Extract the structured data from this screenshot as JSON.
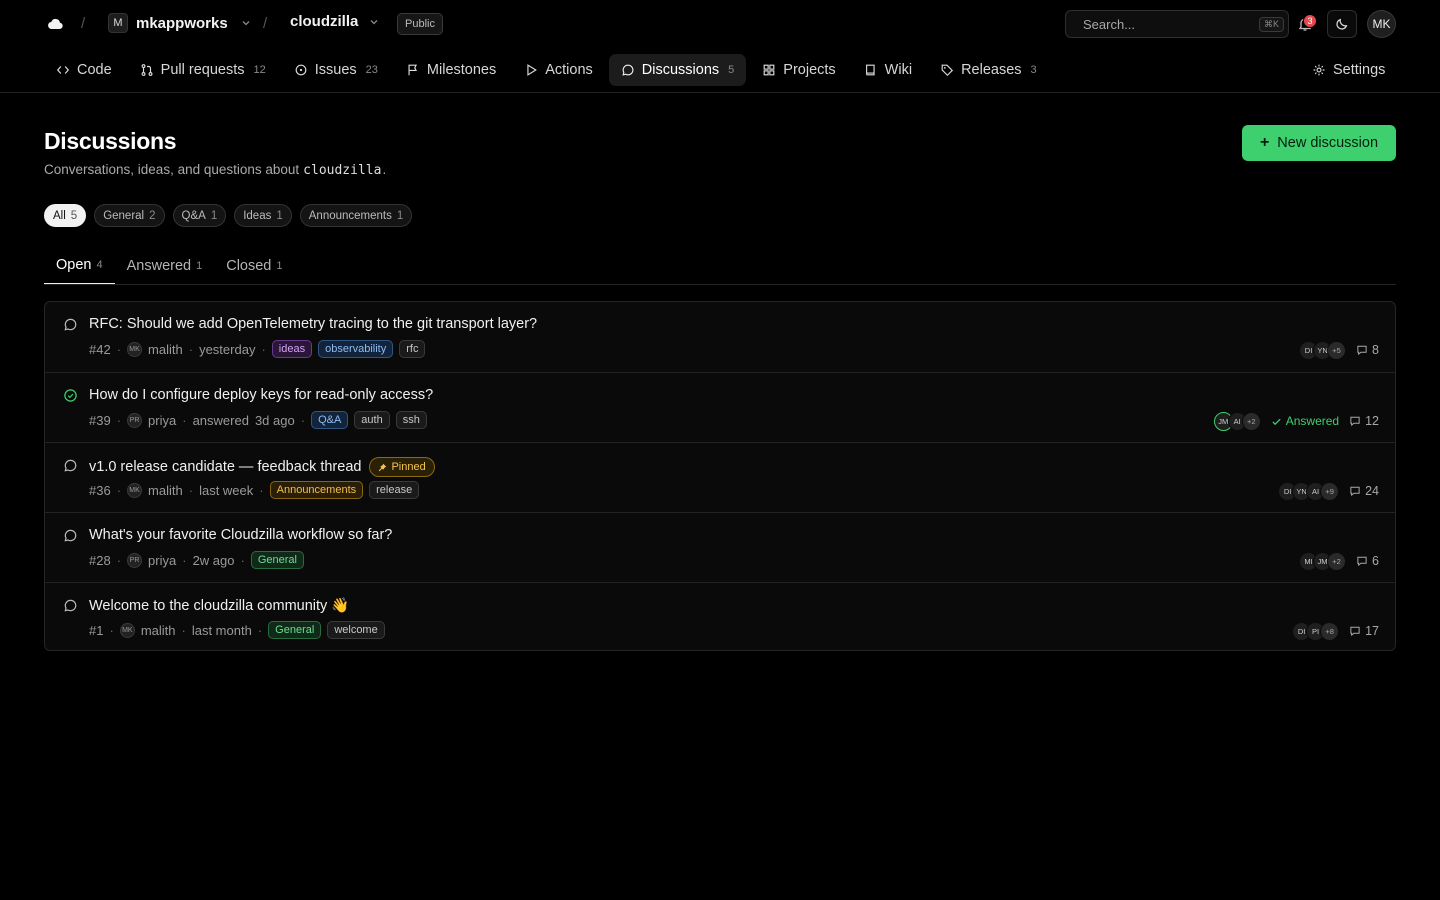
{
  "topbar": {
    "org_initial": "M",
    "org_name": "mkappworks",
    "repo_name": "cloudzilla",
    "visibility": "Public",
    "search_placeholder": "Search...",
    "search_shortcut": "⌘K",
    "notification_count": "3",
    "user_initials": "MK"
  },
  "nav": {
    "items": [
      {
        "label": "Code",
        "count": ""
      },
      {
        "label": "Pull requests",
        "count": "12"
      },
      {
        "label": "Issues",
        "count": "23"
      },
      {
        "label": "Milestones",
        "count": ""
      },
      {
        "label": "Actions",
        "count": ""
      },
      {
        "label": "Discussions",
        "count": "5"
      },
      {
        "label": "Projects",
        "count": ""
      },
      {
        "label": "Wiki",
        "count": ""
      },
      {
        "label": "Releases",
        "count": "3"
      }
    ],
    "settings_label": "Settings"
  },
  "header": {
    "title": "Discussions",
    "description_prefix": "Conversations, ideas, and questions about",
    "description_repo": "cloudzilla",
    "description_suffix": ".",
    "new_button_label": "New discussion"
  },
  "categories": [
    {
      "label": "All",
      "count": "5"
    },
    {
      "label": "General",
      "count": "2"
    },
    {
      "label": "Q&A",
      "count": "1"
    },
    {
      "label": "Ideas",
      "count": "1"
    },
    {
      "label": "Announcements",
      "count": "1"
    }
  ],
  "status_tabs": [
    {
      "label": "Open",
      "count": "4"
    },
    {
      "label": "Answered",
      "count": "1"
    },
    {
      "label": "Closed",
      "count": "1"
    }
  ],
  "discussions": [
    {
      "title": "RFC: Should we add OpenTelemetry tracing to the git transport layer?",
      "number": "#42",
      "author_initials": "MK",
      "author": "malith",
      "time": "yesterday",
      "tags": [
        "ideas",
        "observability",
        "rfc"
      ],
      "participants": [
        "DI",
        "YN"
      ],
      "more": "+5",
      "comments": "8"
    },
    {
      "title": "How do I configure deploy keys for read-only access?",
      "number": "#39",
      "author_initials": "PR",
      "author": "priya",
      "action": "answered",
      "time": "3d ago",
      "tags": [
        "Q&A",
        "auth",
        "ssh"
      ],
      "participants": [
        "JM",
        "AI"
      ],
      "more": "+2",
      "answered_label": "Answered",
      "comments": "12"
    },
    {
      "title": "v1.0 release candidate — feedback thread",
      "pinned_label": "Pinned",
      "number": "#36",
      "author_initials": "MK",
      "author": "malith",
      "time": "last week",
      "tags": [
        "Announcements",
        "release"
      ],
      "participants": [
        "DI",
        "YN",
        "AI"
      ],
      "more": "+9",
      "comments": "24"
    },
    {
      "title": "What's your favorite Cloudzilla workflow so far?",
      "number": "#28",
      "author_initials": "PR",
      "author": "priya",
      "time": "2w ago",
      "tags": [
        "General"
      ],
      "participants": [
        "MI",
        "JM"
      ],
      "more": "+2",
      "comments": "6"
    },
    {
      "title": "Welcome to the cloudzilla community 👋",
      "number": "#1",
      "author_initials": "MK",
      "author": "malith",
      "time": "last month",
      "tags": [
        "General",
        "welcome"
      ],
      "participants": [
        "DI",
        "PI"
      ],
      "more": "+8",
      "comments": "17"
    }
  ],
  "icons": {
    "logo": "cloud-icon",
    "accent": "#3ecf6e"
  }
}
